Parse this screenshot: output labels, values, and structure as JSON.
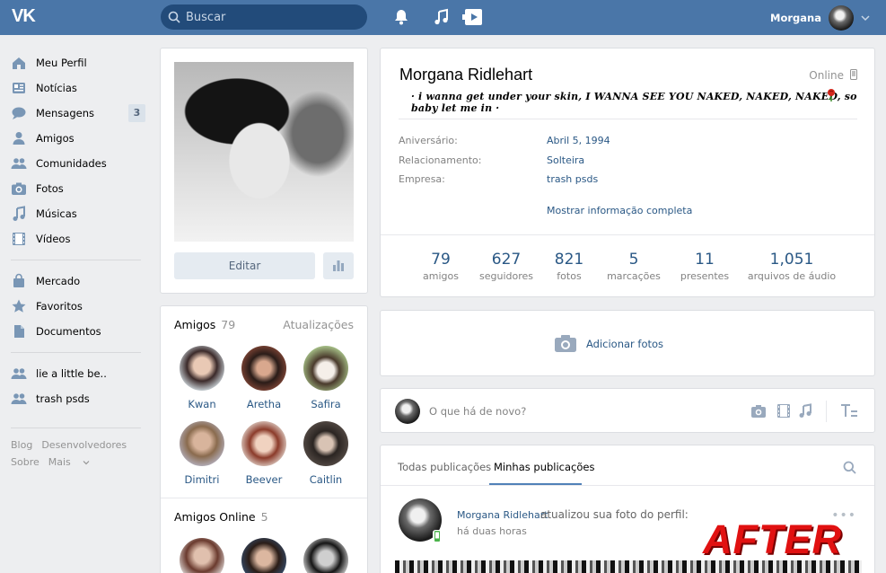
{
  "colors": {
    "topbar": "#4a76a8",
    "link": "#2a5885",
    "accent": "#5181b8",
    "after": "#e11111"
  },
  "topbar": {
    "logo": "VK",
    "search_placeholder": "Buscar",
    "icons": [
      "bell-icon",
      "music-icon",
      "video-play-icon"
    ],
    "user_name": "Morgana"
  },
  "leftnav": {
    "items": [
      {
        "label": "Meu Perfil",
        "icon": "home-icon"
      },
      {
        "label": "Notícias",
        "icon": "news-icon"
      },
      {
        "label": "Mensagens",
        "icon": "chat-icon",
        "badge": "3"
      },
      {
        "label": "Amigos",
        "icon": "person-icon"
      },
      {
        "label": "Comunidades",
        "icon": "group-icon"
      },
      {
        "label": "Fotos",
        "icon": "camera-icon"
      },
      {
        "label": "Músicas",
        "icon": "music-icon"
      },
      {
        "label": "Vídeos",
        "icon": "film-icon"
      }
    ],
    "items2": [
      {
        "label": "Mercado",
        "icon": "bag-icon"
      },
      {
        "label": "Favoritos",
        "icon": "star-icon"
      },
      {
        "label": "Documentos",
        "icon": "document-icon"
      }
    ],
    "items3": [
      {
        "label": "lie a little be..",
        "icon": "group-icon"
      },
      {
        "label": "trash psds",
        "icon": "group-icon"
      }
    ],
    "footer": [
      "Blog",
      "Desenvolvedores",
      "Sobre",
      "Mais"
    ]
  },
  "photo_card": {
    "edit_label": "Editar"
  },
  "friends": {
    "title": "Amigos",
    "count": "79",
    "updates_link": "Atualizações",
    "list": [
      "Kwan",
      "Aretha",
      "Safira",
      "Dimitri",
      "Beever",
      "Caitlin"
    ],
    "online_title": "Amigos Online",
    "online_count": "5"
  },
  "profile": {
    "name": "Morgana Ridlehart",
    "online": "Online",
    "status": "· i wanna get under your skin, I WANNA SEE YOU NAKED, NAKED, NAKED, so baby let me in ·",
    "rows": [
      {
        "key": "Aniversário:",
        "value": "Abril 5, 1994"
      },
      {
        "key": "Relacionamento:",
        "value": "Solteira"
      },
      {
        "key": "Empresa:",
        "value": "trash psds"
      }
    ],
    "show_more": "Mostrar informação completa",
    "counts": [
      {
        "num": "79",
        "label": "amigos"
      },
      {
        "num": "627",
        "label": "seguidores"
      },
      {
        "num": "821",
        "label": "fotos"
      },
      {
        "num": "5",
        "label": "marcações"
      },
      {
        "num": "11",
        "label": "presentes"
      },
      {
        "num": "1,051",
        "label": "arquivos de áudio"
      }
    ]
  },
  "add_photos": {
    "label": "Adicionar fotos"
  },
  "post_box": {
    "placeholder": "O que há de novo?"
  },
  "wall": {
    "tabs": [
      "Todas publicações",
      "Minhas publicações"
    ],
    "feed": {
      "author": "Morgana Ridlehart",
      "action": "atualizou sua foto do perfil:",
      "time": "há duas horas"
    }
  },
  "overlay": {
    "after": "AFTER"
  }
}
